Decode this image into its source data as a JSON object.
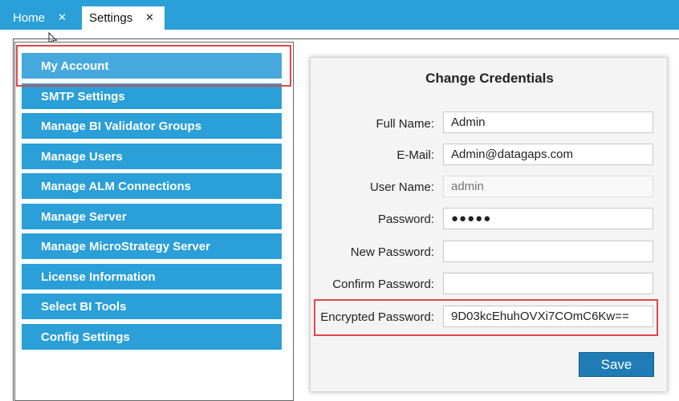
{
  "tabs": [
    {
      "label": "Home",
      "close": "✕"
    },
    {
      "label": "Settings",
      "close": "✕"
    }
  ],
  "menu": {
    "items": [
      {
        "label": "My Account"
      },
      {
        "label": "SMTP Settings"
      },
      {
        "label": "Manage BI Validator Groups"
      },
      {
        "label": "Manage Users"
      },
      {
        "label": "Manage ALM Connections"
      },
      {
        "label": "Manage Server"
      },
      {
        "label": "Manage MicroStrategy Server"
      },
      {
        "label": "License Information"
      },
      {
        "label": "Select BI Tools"
      },
      {
        "label": "Config Settings"
      }
    ]
  },
  "form": {
    "title": "Change Credentials",
    "full_name": {
      "label": "Full Name:",
      "value": "Admin"
    },
    "email": {
      "label": "E-Mail:",
      "value": "Admin@datagaps.com"
    },
    "user_name": {
      "label": "User Name:",
      "placeholder": "admin"
    },
    "password": {
      "label": "Password:",
      "value": "●●●●●"
    },
    "new_password": {
      "label": "New Password:",
      "value": ""
    },
    "confirm_password": {
      "label": "Confirm Password:",
      "value": ""
    },
    "encrypted_password": {
      "label": "Encrypted Password:",
      "value": "9D03kcEhuhOVXi7COmC6Kw=="
    },
    "save_label": "Save"
  },
  "colors": {
    "accent": "#2a9fd8",
    "highlight": "#e0474c",
    "save_button": "#1f7cb4"
  }
}
